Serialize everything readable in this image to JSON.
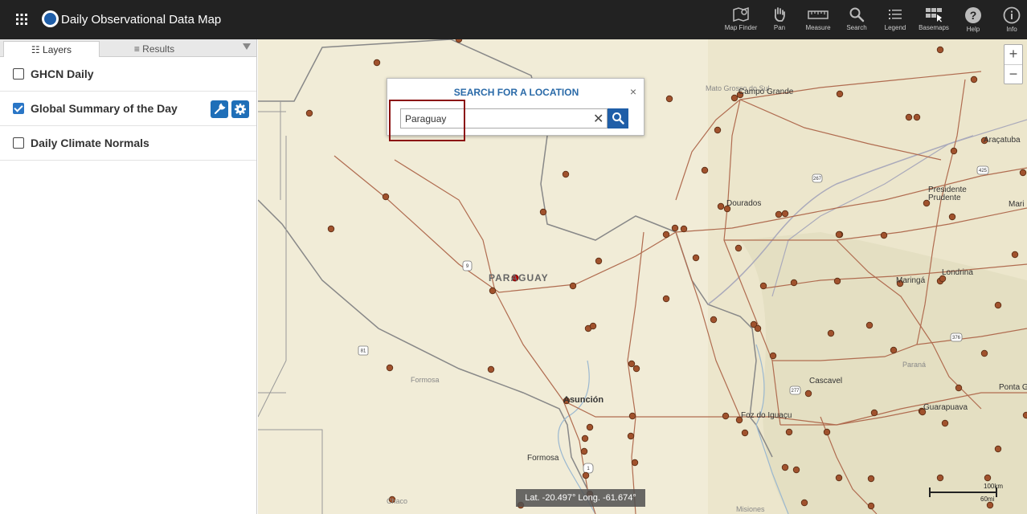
{
  "header": {
    "title": "Daily Observational Data Map",
    "tools": [
      {
        "label": "Map Finder",
        "icon": "map-finder-icon"
      },
      {
        "label": "Pan",
        "icon": "hand-icon"
      },
      {
        "label": "Measure",
        "icon": "ruler-icon"
      },
      {
        "label": "Search",
        "icon": "search-icon"
      },
      {
        "label": "Legend",
        "icon": "list-icon"
      },
      {
        "label": "Basemaps",
        "icon": "basemaps-icon"
      },
      {
        "label": "Help",
        "icon": "help-icon"
      },
      {
        "label": "Info",
        "icon": "info-icon"
      }
    ]
  },
  "sidebar": {
    "tabs": [
      {
        "label": "Layers",
        "active": true
      },
      {
        "label": "Results",
        "active": false
      }
    ],
    "layers": [
      {
        "name": "GHCN Daily",
        "checked": false
      },
      {
        "name": "Global Summary of the Day",
        "checked": true
      },
      {
        "name": "Daily Climate Normals",
        "checked": false
      }
    ]
  },
  "search": {
    "title": "SEARCH FOR A LOCATION",
    "value": "Paraguay",
    "close": "×",
    "clear": "✕"
  },
  "map": {
    "zoom_in": "+",
    "zoom_out": "−",
    "coords": "Lat. -20.497° Long. -61.674°",
    "scale_km": "100km",
    "scale_mi": "60mi",
    "labels": {
      "mato_grosso": "Mato Grosso do Sul",
      "campo_grande": "Campo Grande",
      "aracatuba": "Araçatuba",
      "presidente_prudente": "Presidente Prudente",
      "dourados": "Dourados",
      "paraguay": "PARAGUAY",
      "londrina": "Londrina",
      "maringa": "Maringá",
      "parana": "Paraná",
      "cascavel": "Cascavel",
      "ponta": "Ponta G",
      "guarapuava": "Guarapuava",
      "foz": "Foz do Iguaçu",
      "asuncion": "Asunción",
      "formosa_prov": "Formosa",
      "formosa_city": "Formosa",
      "chaco": "Chaco",
      "misiones": "Misiones",
      "mari": "Mari"
    },
    "road_shields": [
      "9",
      "81",
      "1",
      "267",
      "425",
      "376",
      "277"
    ]
  },
  "colors": {
    "header_bg": "#222222",
    "accent": "#1f5ea8",
    "station": "#a0522d",
    "highlight": "#8b1111",
    "land": "#f1ecd7"
  }
}
